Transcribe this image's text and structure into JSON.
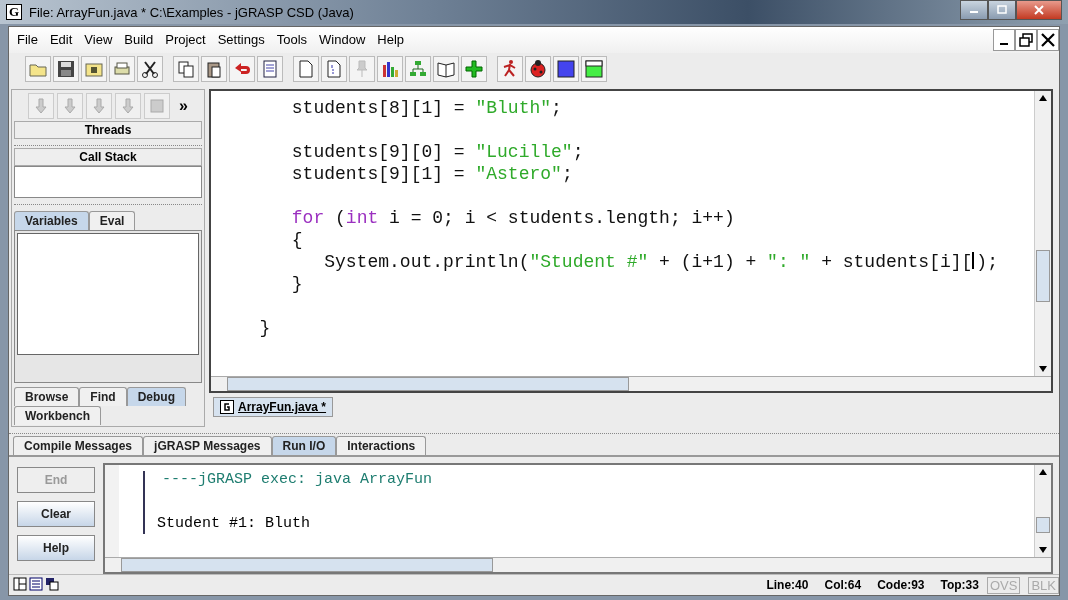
{
  "window": {
    "title": "File: ArrayFun.java *  C:\\Examples - jGRASP CSD (Java)",
    "app_icon": "G"
  },
  "menu": [
    "File",
    "Edit",
    "View",
    "Build",
    "Project",
    "Settings",
    "Tools",
    "Window",
    "Help"
  ],
  "debug_panel": {
    "overflow": "»",
    "threads": "Threads",
    "call_stack": "Call Stack",
    "tabs": [
      {
        "label": "Variables",
        "selected": true
      },
      {
        "label": "Eval",
        "selected": false
      }
    ]
  },
  "browse_tabs": [
    {
      "label": "Browse",
      "selected": false
    },
    {
      "label": "Find",
      "selected": false
    },
    {
      "label": "Debug",
      "selected": true
    },
    {
      "label": "Workbench",
      "selected": false
    }
  ],
  "editor": {
    "lines": [
      {
        "kind": "code",
        "tokens": [
          {
            "kind": "plain",
            "text": "      students[8][1] = "
          },
          {
            "kind": "string",
            "text": "\"Bluth\""
          },
          {
            "kind": "plain",
            "text": ";"
          }
        ]
      },
      {
        "kind": "blank"
      },
      {
        "kind": "code",
        "tokens": [
          {
            "kind": "plain",
            "text": "      students[9][0] = "
          },
          {
            "kind": "string",
            "text": "\"Lucille\""
          },
          {
            "kind": "plain",
            "text": ";"
          }
        ]
      },
      {
        "kind": "code",
        "tokens": [
          {
            "kind": "plain",
            "text": "      students[9][1] = "
          },
          {
            "kind": "string",
            "text": "\"Astero\""
          },
          {
            "kind": "plain",
            "text": ";"
          }
        ]
      },
      {
        "kind": "blank"
      },
      {
        "kind": "code",
        "tokens": [
          {
            "kind": "keyword",
            "text": "      for"
          },
          {
            "kind": "plain",
            "text": " ("
          },
          {
            "kind": "keyword",
            "text": "int"
          },
          {
            "kind": "plain",
            "text": " i = 0; i < students.length; i++)"
          }
        ]
      },
      {
        "kind": "code",
        "tokens": [
          {
            "kind": "plain",
            "text": "      {"
          }
        ]
      },
      {
        "kind": "code",
        "tokens": [
          {
            "kind": "plain",
            "text": "         System.out.println("
          },
          {
            "kind": "string",
            "text": "\"Student #\""
          },
          {
            "kind": "plain",
            "text": " + (i+1) + "
          },
          {
            "kind": "string",
            "text": "\": \""
          },
          {
            "kind": "plain",
            "text": " + students[i]["
          },
          {
            "kind": "caret"
          },
          {
            "kind": "plain",
            "text": ");"
          }
        ]
      },
      {
        "kind": "code",
        "tokens": [
          {
            "kind": "plain",
            "text": "      }"
          }
        ]
      },
      {
        "kind": "blank"
      },
      {
        "kind": "code",
        "tokens": [
          {
            "kind": "plain",
            "text": "   }"
          }
        ]
      }
    ],
    "file_tabs": [
      {
        "label": "ArrayFun.java *",
        "selected": true
      }
    ]
  },
  "bottom_tabs": [
    {
      "label": "Compile Messages",
      "selected": false
    },
    {
      "label": "jGRASP Messages",
      "selected": false
    },
    {
      "label": "Run I/O",
      "selected": true
    },
    {
      "label": "Interactions",
      "selected": false
    }
  ],
  "run_io": {
    "buttons": [
      {
        "label": "End",
        "disabled": true
      },
      {
        "label": "Clear",
        "disabled": false
      },
      {
        "label": "Help",
        "disabled": false
      }
    ],
    "output": [
      {
        "kind": "exec",
        "text": " ----jGRASP exec: java ArrayFun"
      },
      {
        "kind": "blank"
      },
      {
        "kind": "out",
        "text": "Student #1: Bluth"
      }
    ]
  },
  "status_bar": {
    "fields": [
      {
        "text": "Line:40"
      },
      {
        "text": "Col:64"
      },
      {
        "text": "Code:93"
      },
      {
        "text": "Top:33"
      }
    ],
    "toggles": [
      {
        "label": "OVS",
        "disabled": true
      },
      {
        "label": "BLK",
        "disabled": true
      }
    ]
  }
}
